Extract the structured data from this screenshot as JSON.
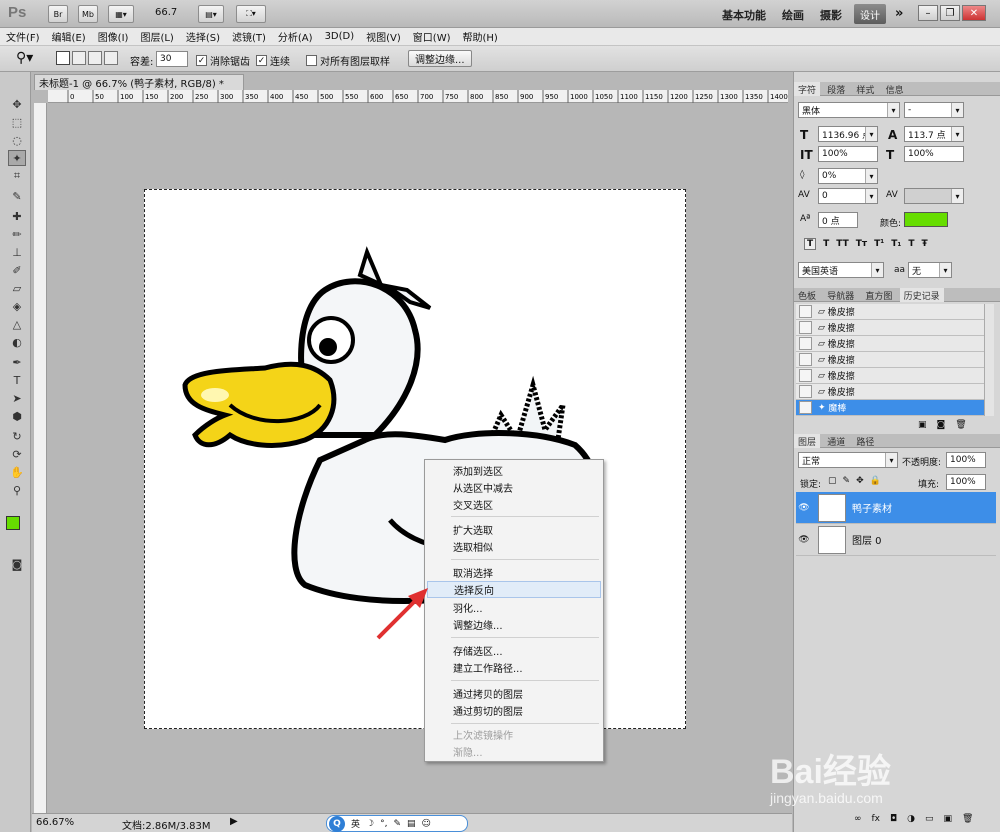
{
  "titlebar": {
    "logo": "Ps",
    "btn_br": "Br",
    "btn_mb": "Mb",
    "zoom_value": "66.7",
    "workspaces": [
      "基本功能",
      "绘画",
      "摄影"
    ],
    "active_workspace": "设计",
    "more": "»"
  },
  "menu": [
    "文件(F)",
    "编辑(E)",
    "图像(I)",
    "图层(L)",
    "选择(S)",
    "滤镜(T)",
    "分析(A)",
    "3D(D)",
    "视图(V)",
    "窗口(W)",
    "帮助(H)"
  ],
  "options": {
    "tolerance_label": "容差:",
    "tolerance_value": "30",
    "antialias_label": "消除锯齿",
    "contiguous_label": "连续",
    "sample_all_label": "对所有图层取样",
    "refine_edge_btn": "调整边缘..."
  },
  "document": {
    "tab_title": "未标题-1 @ 66.7% (鸭子素材, RGB/8) *",
    "ruler_ticks": [
      "0",
      "50",
      "100",
      "150",
      "200",
      "250",
      "300",
      "350",
      "400",
      "450",
      "500",
      "550",
      "600",
      "650",
      "700",
      "750",
      "800",
      "850",
      "900",
      "950",
      "1000",
      "1050",
      "1100",
      "1150",
      "1200",
      "1250",
      "1300",
      "1350",
      "1400"
    ]
  },
  "context_menu": {
    "items": [
      {
        "label": "添加到选区",
        "disabled": false
      },
      {
        "label": "从选区中减去",
        "disabled": false
      },
      {
        "label": "交叉选区",
        "disabled": false
      },
      {
        "label": "扩大选取",
        "disabled": false
      },
      {
        "label": "选取相似",
        "disabled": false
      },
      {
        "label": "取消选择",
        "disabled": false
      },
      {
        "label": "选择反向",
        "disabled": false
      },
      {
        "label": "羽化...",
        "disabled": false
      },
      {
        "label": "调整边缘...",
        "disabled": false
      },
      {
        "label": "存储选区...",
        "disabled": false
      },
      {
        "label": "建立工作路径...",
        "disabled": false
      },
      {
        "label": "通过拷贝的图层",
        "disabled": false
      },
      {
        "label": "通过剪切的图层",
        "disabled": false
      },
      {
        "label": "上次滤镜操作",
        "disabled": true
      },
      {
        "label": "渐隐...",
        "disabled": true
      }
    ],
    "highlighted": "选择反向"
  },
  "character_panel": {
    "tabs": [
      "字符",
      "段落",
      "样式",
      "信息"
    ],
    "font_family": "黑体",
    "font_style": "-",
    "font_size": "1136.96 点",
    "leading": "113.7 点",
    "vertical_scale": "100%",
    "horizontal_scale": "100%",
    "tsume": "0%",
    "kerning": "0",
    "baseline_shift": "0 点",
    "color_label": "颜色:",
    "color_value": "#66dd00",
    "language": "美国英语",
    "antialias_prefix": "aa",
    "antialias": "无"
  },
  "history_panel": {
    "tabs": [
      "色板",
      "导航器",
      "直方图",
      "历史记录"
    ],
    "items": [
      "橡皮擦",
      "橡皮擦",
      "橡皮擦",
      "橡皮擦",
      "橡皮擦",
      "橡皮擦",
      "魔棒"
    ],
    "active_index": 6
  },
  "layers_panel": {
    "tabs": [
      "图层",
      "通道",
      "路径"
    ],
    "blend_mode": "正常",
    "opacity_label": "不透明度:",
    "opacity_value": "100%",
    "lock_label": "锁定:",
    "fill_label": "填充:",
    "fill_value": "100%",
    "layers": [
      {
        "name": "鸭子素材",
        "selected": true
      },
      {
        "name": "图层 0",
        "selected": false
      }
    ]
  },
  "status": {
    "zoom": "66.67%",
    "doc_info": "文档:2.86M/3.83M"
  },
  "ime_bar": {
    "lang": "英"
  },
  "watermark": {
    "brand": "Bai经验",
    "url": "jingyan.baidu.com"
  }
}
